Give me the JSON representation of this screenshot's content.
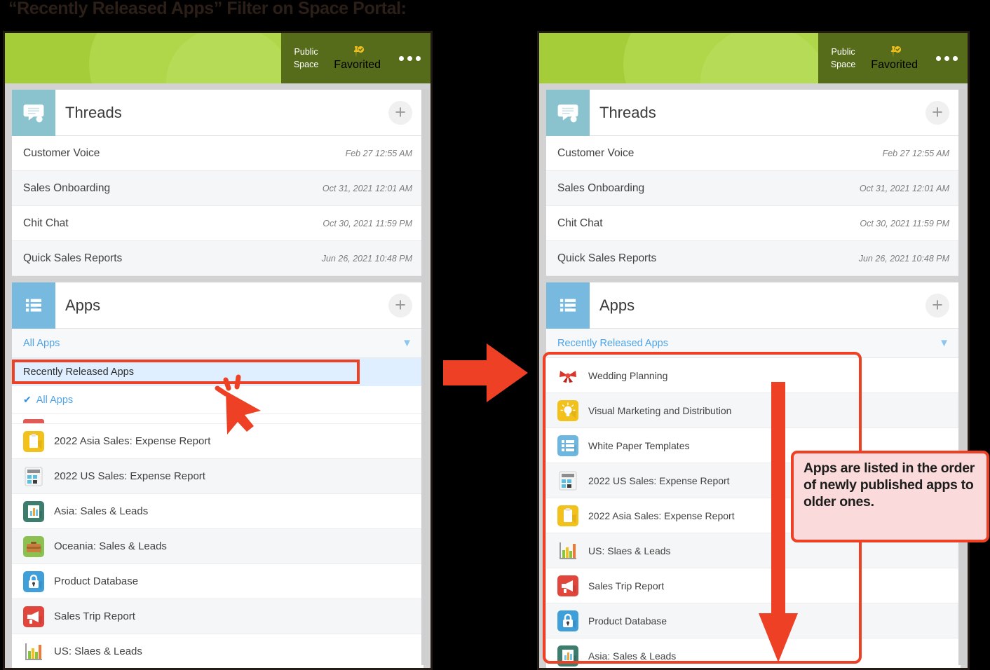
{
  "title": "“Recently Released Apps” Filter on Space Portal:",
  "colors": {
    "accent_green": "#a4cd39",
    "header_dark_green": "#566c1b",
    "annotation_red": "#ee4024",
    "link_blue": "#4ea3e8",
    "callout_bg": "#fadadb"
  },
  "header": {
    "public_space_line1": "Public",
    "public_space_line2": "Space",
    "favorited_label": "Favorited",
    "favorited_icon": "pin-check-icon",
    "overflow_icon": "more-options-icon"
  },
  "threads": {
    "title": "Threads",
    "badge_icon": "threads-speech-bubble-icon",
    "add_label": "+",
    "items": [
      {
        "name": "Customer Voice",
        "date": "Feb 27 12:55 AM"
      },
      {
        "name": "Sales Onboarding",
        "date": "Oct 31, 2021 12:01 AM"
      },
      {
        "name": "Chit Chat",
        "date": "Oct 30, 2021 11:59 PM"
      },
      {
        "name": "Quick Sales Reports",
        "date": "Jun 26, 2021 10:48 PM"
      }
    ]
  },
  "apps_left": {
    "title": "Apps",
    "badge_icon": "apps-list-icon",
    "add_label": "+",
    "filter_value": "All Apps",
    "chevron_icon": "chevron-down-icon",
    "dropdown": {
      "highlighted_option": "Recently Released Apps",
      "checked_option": "All Apps",
      "check_icon": "check-icon"
    },
    "items": [
      {
        "name": "2022 Asia Sales: Expense Report",
        "icon": "clipboard-icon"
      },
      {
        "name": "2022 US Sales: Expense Report",
        "icon": "calculator-icon"
      },
      {
        "name": "Asia: Sales & Leads",
        "icon": "bar-chart-dark-icon"
      },
      {
        "name": "Oceania: Sales & Leads",
        "icon": "briefcase-icon"
      },
      {
        "name": "Product Database",
        "icon": "lock-icon"
      },
      {
        "name": "Sales Trip Report",
        "icon": "megaphone-icon"
      },
      {
        "name": "US: Slaes & Leads",
        "icon": "bar-graph-icon"
      }
    ]
  },
  "apps_right": {
    "title": "Apps",
    "badge_icon": "apps-list-icon",
    "add_label": "+",
    "filter_value": "Recently Released Apps",
    "chevron_icon": "chevron-down-icon",
    "items": [
      {
        "name": "Wedding Planning",
        "icon": "ribbon-bow-icon"
      },
      {
        "name": "Visual Marketing and Distribution",
        "icon": "lightbulb-icon"
      },
      {
        "name": "White Paper Templates",
        "icon": "apps-list-icon"
      },
      {
        "name": "2022 US Sales: Expense Report",
        "icon": "calculator-icon"
      },
      {
        "name": "2022 Asia Sales: Expense Report",
        "icon": "clipboard-icon"
      },
      {
        "name": "US: Slaes & Leads",
        "icon": "bar-graph-icon"
      },
      {
        "name": "Sales Trip Report",
        "icon": "megaphone-icon"
      },
      {
        "name": "Product Database",
        "icon": "lock-icon"
      },
      {
        "name": "Asia: Sales & Leads",
        "icon": "bar-chart-dark-icon"
      }
    ]
  },
  "annotations": {
    "callout_text": "Apps are listed in the order of newly published apps to older ones.",
    "flow_arrow_icon": "right-arrow-icon",
    "order_arrow_icon": "down-arrow-icon",
    "cursor_icon": "click-cursor-icon"
  }
}
